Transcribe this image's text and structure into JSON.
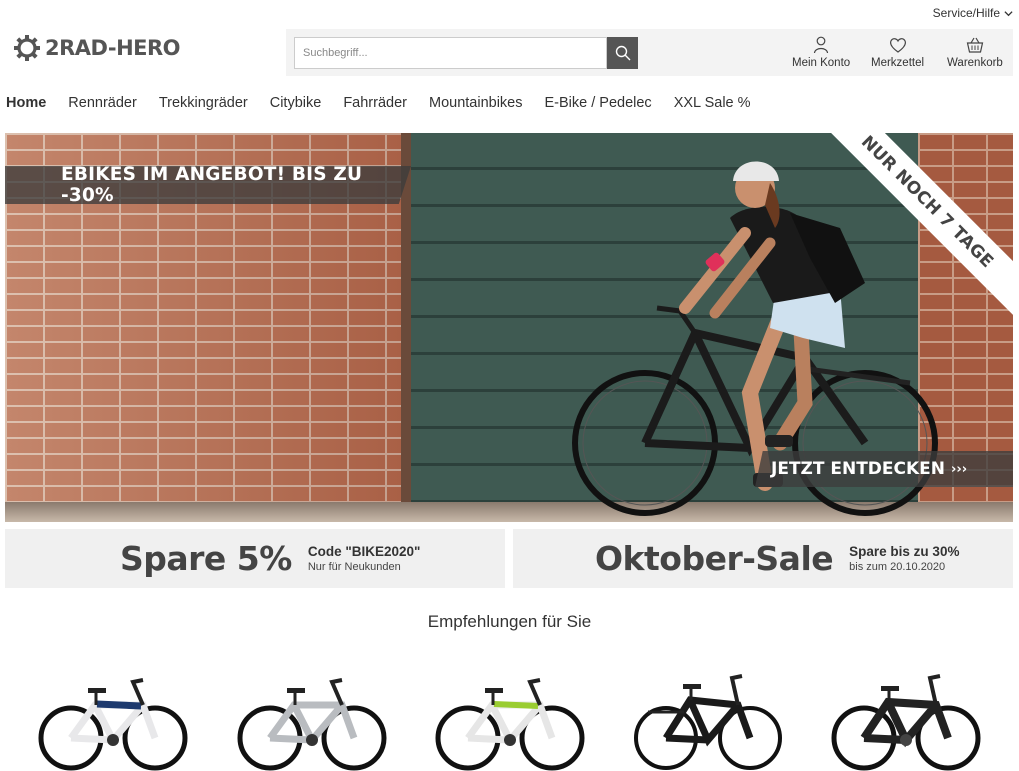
{
  "topbar": {
    "service_label": "Service/Hilfe"
  },
  "header": {
    "logo_text": "2RAD-HERO",
    "search": {
      "placeholder": "Suchbegriff..."
    },
    "actions": {
      "account": "Mein Konto",
      "wishlist": "Merkzettel",
      "cart": "Warenkorb"
    }
  },
  "nav": {
    "items": [
      "Home",
      "Rennräder",
      "Trekkingräder",
      "Citybike",
      "Fahrräder",
      "Mountainbikes",
      "E-Bike / Pedelec",
      "XXL Sale %"
    ],
    "active_index": 0
  },
  "hero": {
    "banner": "EBIKES IM ANGEBOT! BIS ZU -30%",
    "ribbon": "NUR NOCH 7 TAGE",
    "cta": "JETZT ENTDECKEN",
    "cta_arrow": "›››"
  },
  "promos": [
    {
      "big": "Spare 5%",
      "line1": "Code \"BIKE2020\"",
      "line2": "Nur für Neukunden"
    },
    {
      "big": "Oktober-Sale",
      "line1": "Spare bis zu 30%",
      "line2": "bis zum 20.10.2020"
    }
  ],
  "recommendations": {
    "title": "Empfehlungen für Sie"
  },
  "colors": {
    "accent_dark": "#555555",
    "bar_bg": "#f0f0f0"
  }
}
